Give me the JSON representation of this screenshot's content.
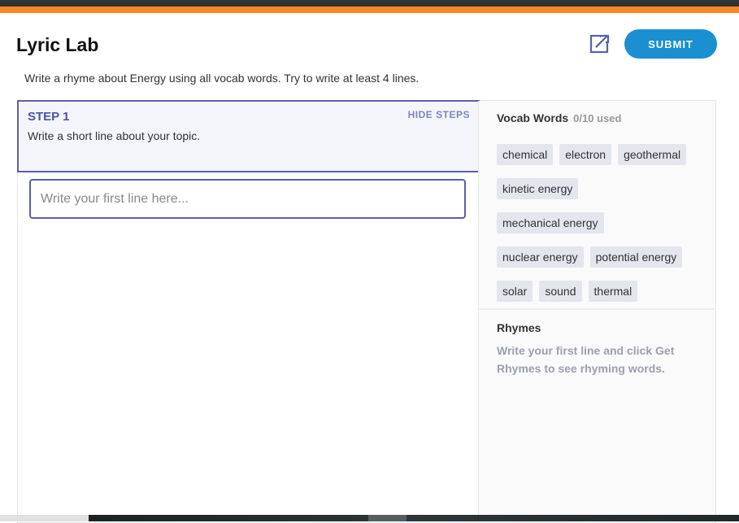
{
  "header": {
    "title": "Lyric Lab",
    "submit_label": "SUBMIT",
    "instructions": "Write a rhyme about Energy using all vocab words. Try to write at least 4 lines."
  },
  "step": {
    "title": "STEP 1",
    "description": "Write a short line about your topic.",
    "hide_label": "HIDE STEPS"
  },
  "line_input": {
    "placeholder": "Write your first line here...",
    "value": ""
  },
  "vocab": {
    "title": "Vocab Words",
    "count": "0/10 used",
    "rows": [
      [
        "chemical",
        "electron",
        "geothermal"
      ],
      [
        "kinetic energy"
      ],
      [
        "mechanical energy"
      ],
      [
        "nuclear energy",
        "potential energy"
      ],
      [
        "solar",
        "sound",
        "thermal"
      ]
    ]
  },
  "rhymes": {
    "title": "Rhymes",
    "text": "Write your first line and click Get Rhymes to see rhyming words."
  },
  "colors": {
    "accent": "#5a5fb0",
    "submit": "#1a8fd1",
    "orange": "#f7891f"
  }
}
